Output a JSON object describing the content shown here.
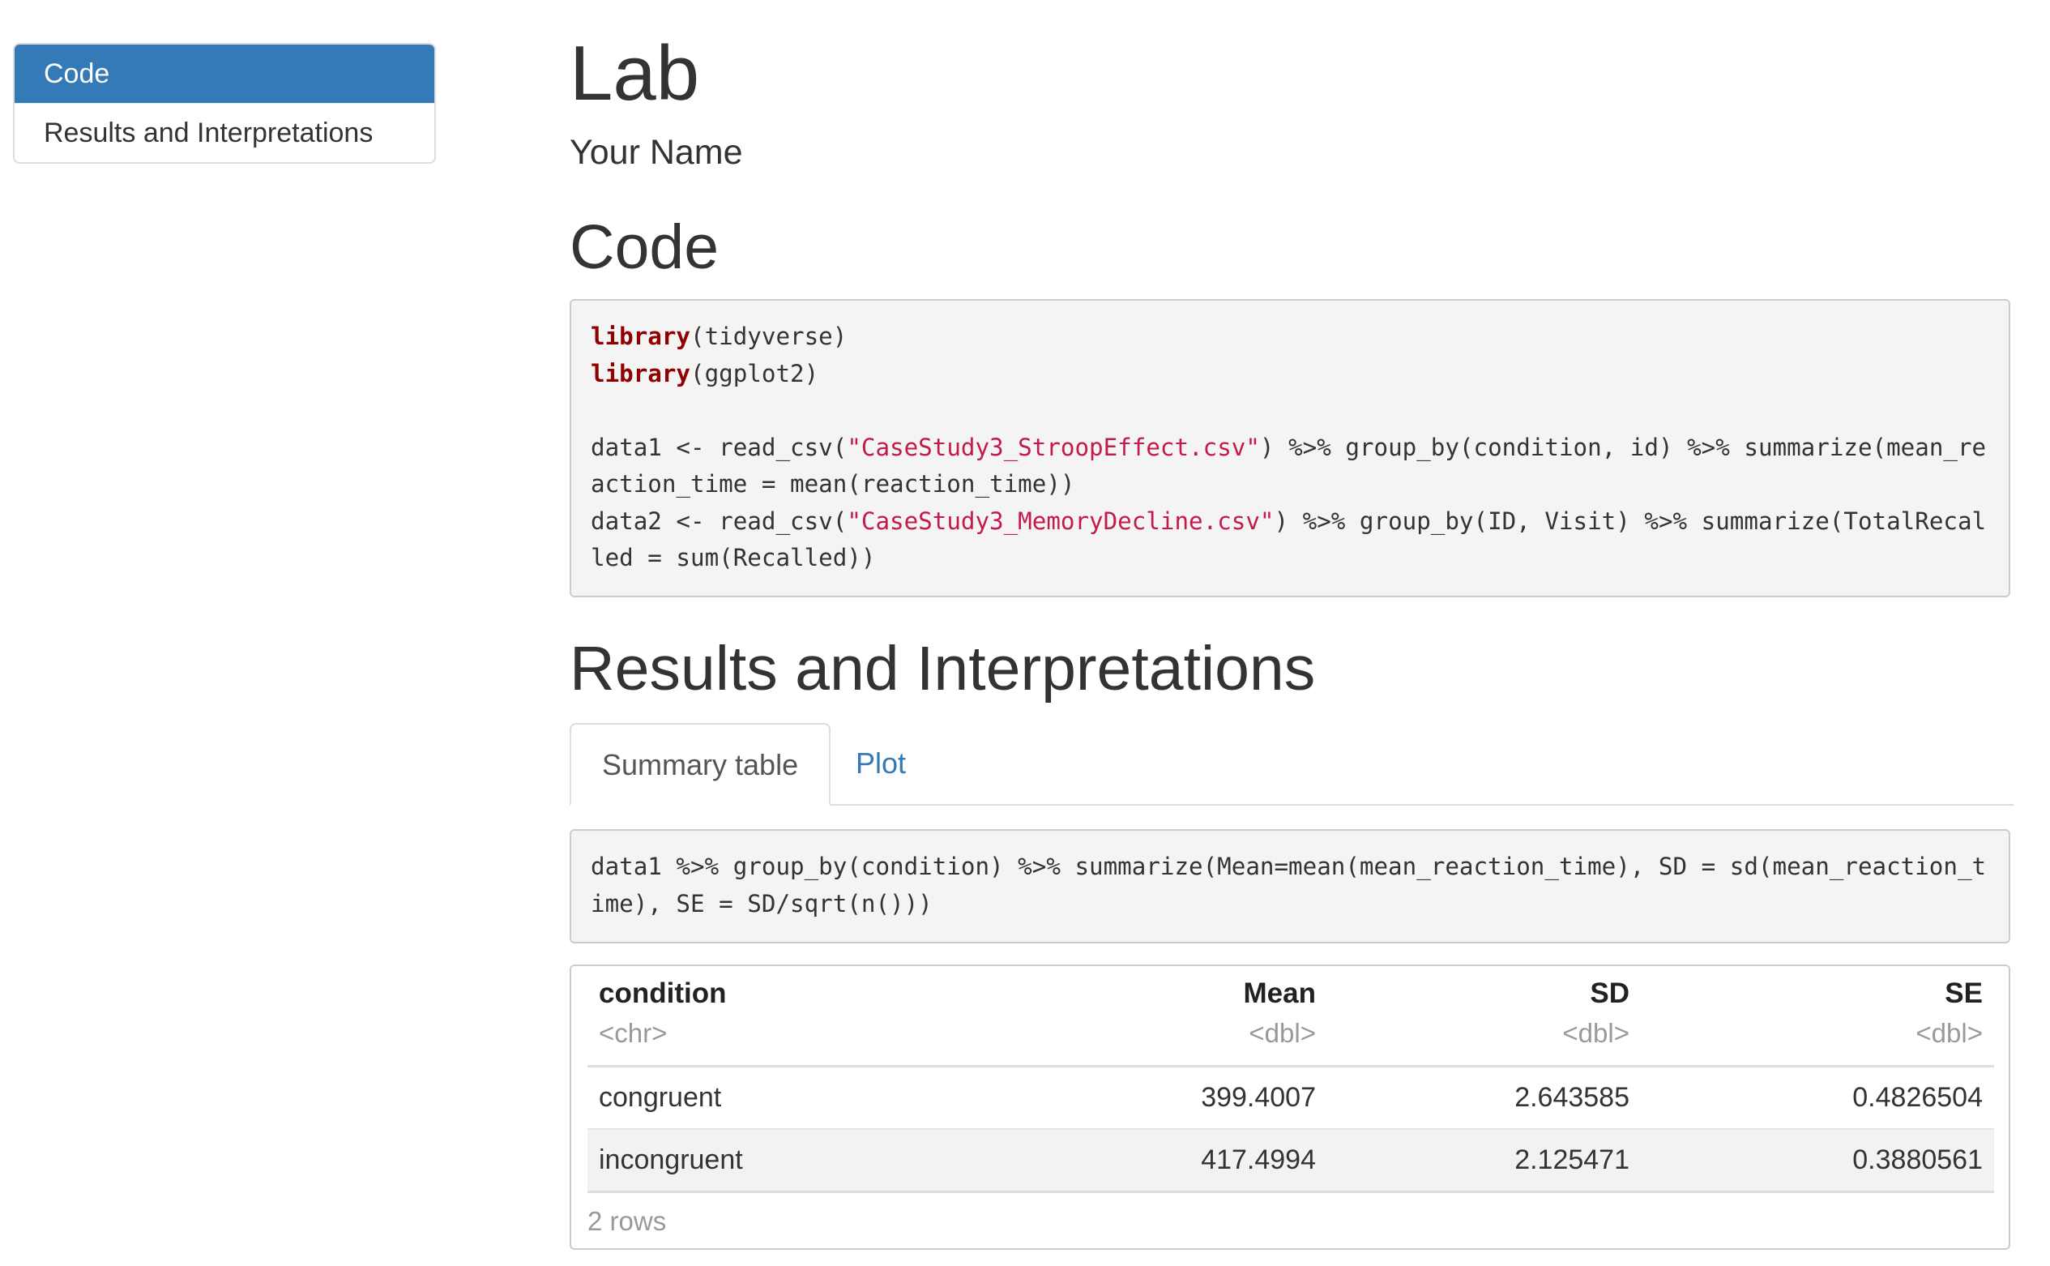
{
  "toc": {
    "items": [
      {
        "label": "Code",
        "active": true
      },
      {
        "label": "Results and Interpretations",
        "active": false
      }
    ]
  },
  "doc": {
    "title": "Lab",
    "author": "Your Name"
  },
  "sections": {
    "code_heading": "Code",
    "results_heading": "Results and Interpretations"
  },
  "code1": {
    "line1_kw": "library",
    "line1_rest": "(tidyverse)",
    "line2_kw": "library",
    "line2_rest": "(ggplot2)",
    "line3_a": "data1 <- read_csv(",
    "line3_str": "\"CaseStudy3_StroopEffect.csv\"",
    "line3_b": ") %>% group_by(condition, id) %>% summarize(mean_reaction_time = mean(reaction_time))",
    "line4_a": "data2 <- read_csv(",
    "line4_str": "\"CaseStudy3_MemoryDecline.csv\"",
    "line4_b": ") %>% group_by(ID, Visit) %>% summarize(TotalRecalled = sum(Recalled))"
  },
  "tabs": {
    "summary_label": "Summary table",
    "plot_label": "Plot"
  },
  "code2": {
    "text": "data1 %>% group_by(condition) %>% summarize(Mean=mean(mean_reaction_time), SD = sd(mean_reaction_time), SE = SD/sqrt(n()))"
  },
  "table": {
    "columns": [
      {
        "name": "condition",
        "type": "<chr>"
      },
      {
        "name": "Mean",
        "type": "<dbl>"
      },
      {
        "name": "SD",
        "type": "<dbl>"
      },
      {
        "name": "SE",
        "type": "<dbl>"
      }
    ],
    "rows": [
      [
        "congruent",
        "399.4007",
        "2.643585",
        "0.4826504"
      ],
      [
        "incongruent",
        "417.4994",
        "2.125471",
        "0.3880561"
      ]
    ],
    "row_count": "2 rows"
  },
  "colors": {
    "accent": "#337ab7",
    "keyword": "#900000",
    "string": "#c41a4a"
  }
}
